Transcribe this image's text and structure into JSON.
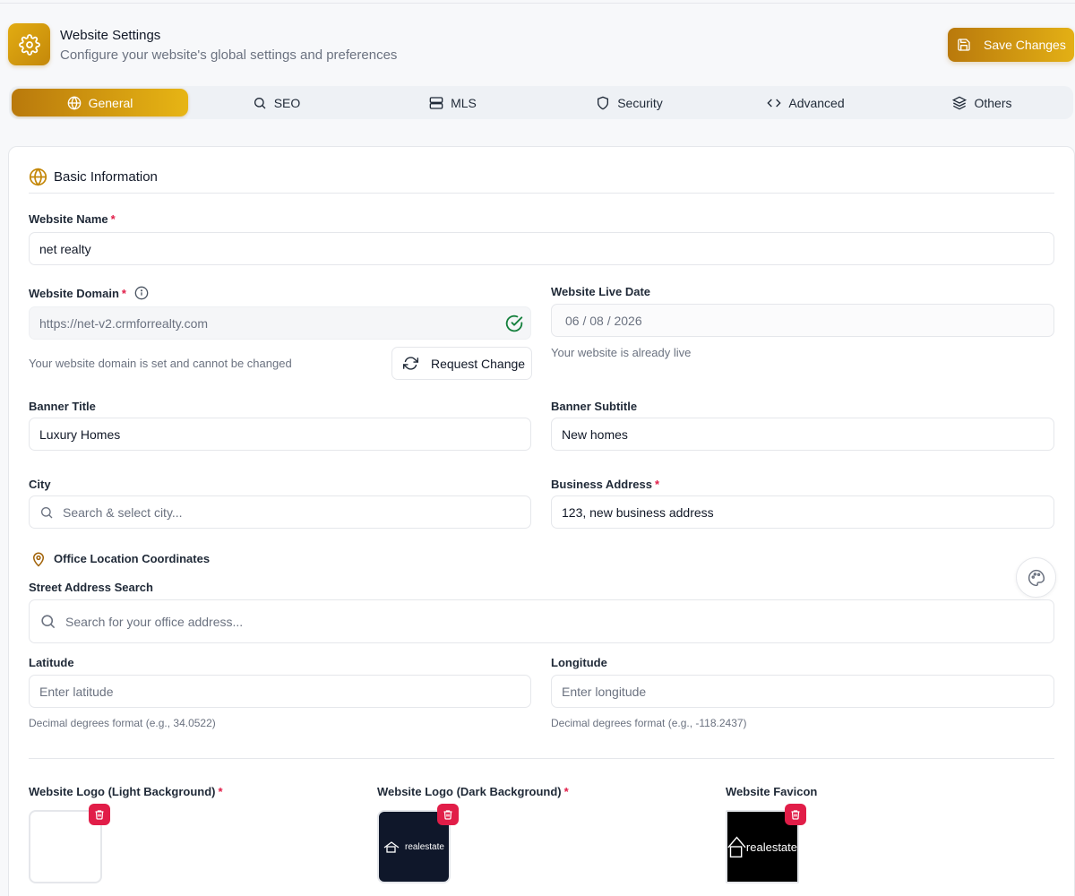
{
  "header": {
    "title": "Website Settings",
    "subtitle": "Configure your website's global settings and preferences",
    "save_label": "Save Changes"
  },
  "tabs": [
    {
      "label": "General",
      "icon": "globe-icon",
      "active": true
    },
    {
      "label": "SEO",
      "icon": "search-icon",
      "active": false
    },
    {
      "label": "MLS",
      "icon": "server-icon",
      "active": false
    },
    {
      "label": "Security",
      "icon": "shield-icon",
      "active": false
    },
    {
      "label": "Advanced",
      "icon": "code-icon",
      "active": false
    },
    {
      "label": "Others",
      "icon": "layers-icon",
      "active": false
    }
  ],
  "basic": {
    "title": "Basic Information",
    "website_name": {
      "label": "Website Name",
      "value": "net realty"
    },
    "domain": {
      "label": "Website Domain",
      "value": "https://net-v2.crmforrealty.com",
      "help": "Your website domain is set and cannot be changed",
      "request_label": "Request Change"
    },
    "live_date": {
      "label": "Website Live Date",
      "value": "06 / 08 / 2026",
      "help": "Your website is already live"
    },
    "banner_title": {
      "label": "Banner Title",
      "value": "Luxury Homes"
    },
    "banner_subtitle": {
      "label": "Banner Subtitle",
      "value": "New homes"
    },
    "city": {
      "label": "City",
      "placeholder": "Search & select city..."
    },
    "business_address": {
      "label": "Business Address",
      "value": "123, new business address"
    }
  },
  "office": {
    "title": "Office Location Coordinates",
    "street_label": "Street Address Search",
    "street_placeholder": "Search for your office address...",
    "latitude": {
      "label": "Latitude",
      "placeholder": "Enter latitude",
      "help": "Decimal degrees format (e.g., 34.0522)"
    },
    "longitude": {
      "label": "Longitude",
      "placeholder": "Enter longitude",
      "help": "Decimal degrees format (e.g., -118.2437)"
    }
  },
  "logos": {
    "light_label": "Website Logo (Light Background)",
    "dark_label": "Website Logo (Dark Background)",
    "favicon_label": "Website Favicon",
    "logo_text": "realestate"
  },
  "colors": {
    "accent": "#d49d10",
    "danger": "#e11d48",
    "success": "#15803d"
  }
}
